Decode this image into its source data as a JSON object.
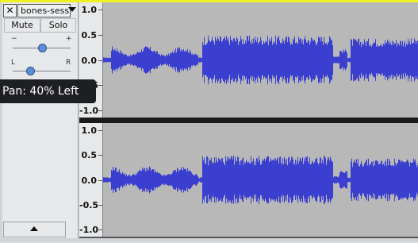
{
  "track": {
    "close_glyph": "✕",
    "name": "bones-sessi",
    "mute_label": "Mute",
    "solo_label": "Solo",
    "gain_minus": "−",
    "gain_plus": "+",
    "pan_left": "L",
    "pan_right": "R",
    "gain_level": 0.5,
    "pan_level": 0.3
  },
  "tooltip": {
    "text": "Pan: 40% Left"
  },
  "ruler_top": [
    "1.0",
    "0.5",
    "0.0",
    "-0.5",
    "-1.0"
  ],
  "ruler_bottom": [
    "1.0",
    "0.5",
    "0.0",
    "-0.5",
    "-1.0"
  ],
  "colors": {
    "waveform": "#3b3fd0",
    "background": "#b8b8b8",
    "selection_border": "#eef122"
  },
  "icons": {
    "close": "close-icon",
    "menu": "chevron-down-icon",
    "collapse": "chevron-up-icon"
  }
}
